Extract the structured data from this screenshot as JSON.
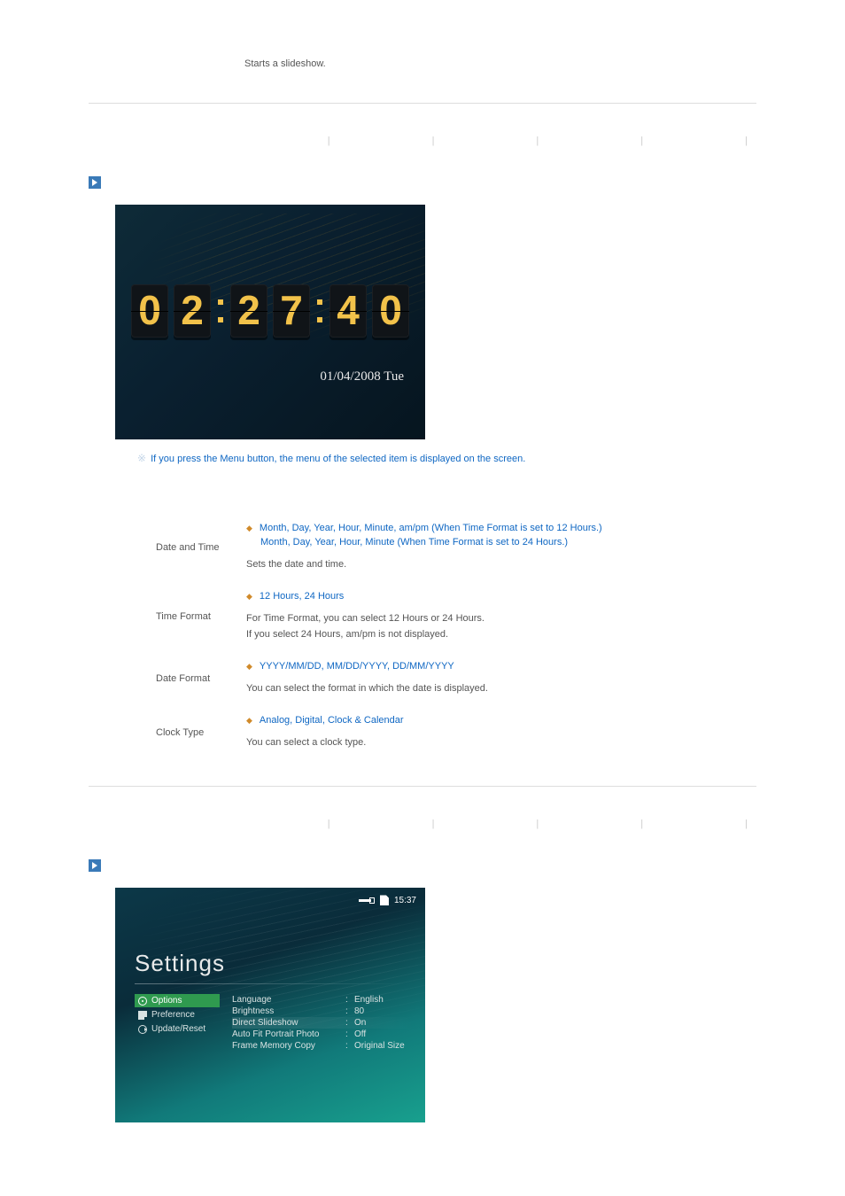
{
  "intro": "Starts a slideshow.",
  "nav_separators": [
    "|",
    "|",
    "|",
    "|",
    "|"
  ],
  "clock": {
    "digits": [
      "0",
      "2",
      "2",
      "7",
      "4",
      "0"
    ],
    "date": "01/04/2008 Tue"
  },
  "note_glyph": "※",
  "note": "If you press the Menu button, the menu of the selected item is displayed on the screen.",
  "spec": {
    "date_and_time": {
      "label": "Date and Time",
      "opt1": "Month, Day, Year, Hour, Minute, am/pm (When Time Format is set to 12 Hours.)",
      "opt2": "Month, Day, Year, Hour, Minute (When Time Format is set to 24 Hours.)",
      "desc": "Sets the date and time."
    },
    "time_format": {
      "label": "Time Format",
      "opt": "12 Hours, 24 Hours",
      "desc1": "For Time Format, you can select 12 Hours or 24 Hours.",
      "desc2": "If you select 24 Hours, am/pm is not displayed."
    },
    "date_format": {
      "label": "Date Format",
      "opt": "YYYY/MM/DD, MM/DD/YYYY, DD/MM/YYYY",
      "desc": "You can select the format in which the date is displayed."
    },
    "clock_type": {
      "label": "Clock Type",
      "opt": "Analog, Digital, Clock & Calendar",
      "desc": "You can select a clock type."
    }
  },
  "settings": {
    "title": "Settings",
    "time": "15:37",
    "nav": {
      "options": "Options",
      "preference": "Preference",
      "update": "Update/Reset"
    },
    "rows": [
      {
        "label": "Language",
        "value": "English"
      },
      {
        "label": "Brightness",
        "value": "80"
      },
      {
        "label": "Direct Slideshow",
        "value": "On"
      },
      {
        "label": "Auto Fit Portrait Photo",
        "value": "Off"
      },
      {
        "label": "Frame Memory Copy",
        "value": "Original Size"
      }
    ]
  }
}
